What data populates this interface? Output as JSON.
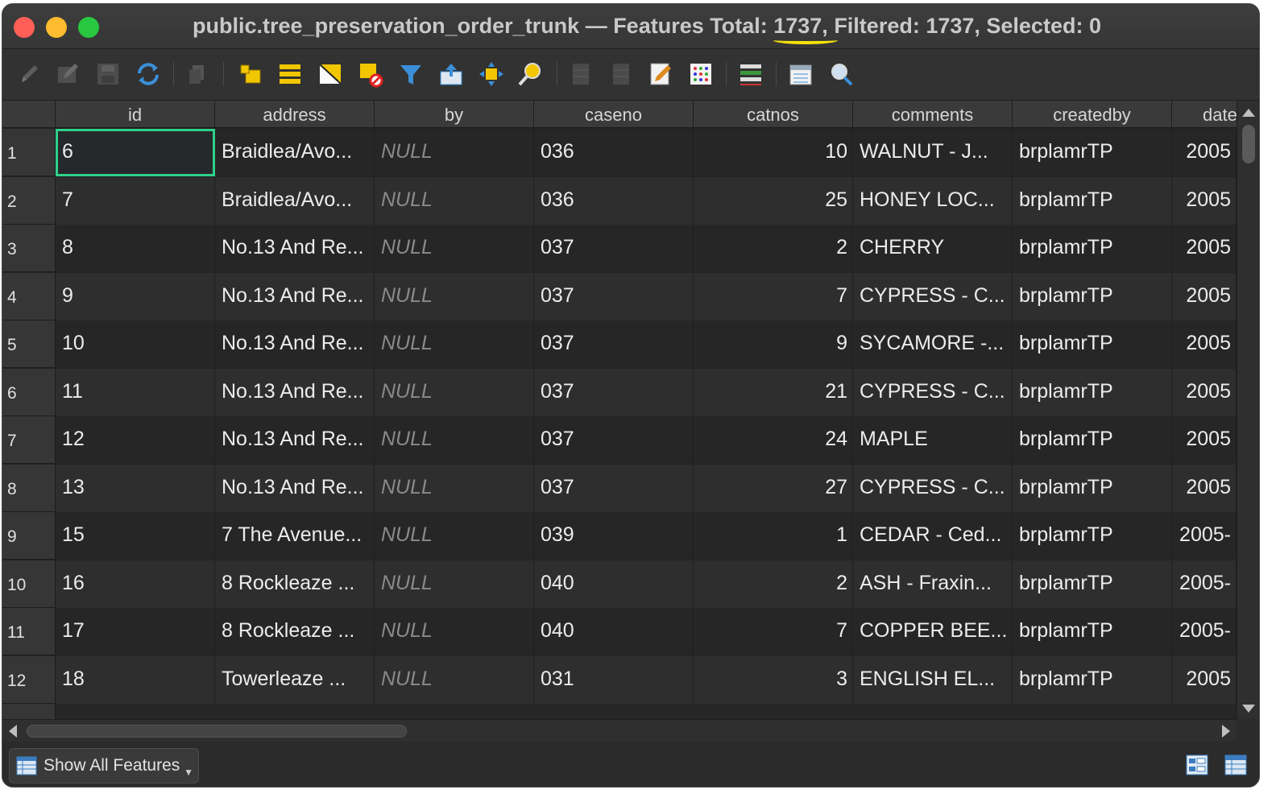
{
  "window": {
    "title_prefix": "public.tree_preservation_order_trunk — Features Total: ",
    "total": "1737,",
    "title_suffix": " Filtered: 1737, Selected: 0"
  },
  "toolbar": {
    "icons": [
      "pencil-icon",
      "multi-edit-icon",
      "save-edits-icon",
      "reload-icon",
      "copy-icon",
      "add-feature-icon",
      "select-all-icon",
      "invert-selection-icon",
      "deselect-icon",
      "filter-icon",
      "move-selection-top-icon",
      "pan-to-selection-icon",
      "zoom-to-selection-icon",
      "new-field-icon",
      "delete-field-icon",
      "field-calculator-icon",
      "conditional-format-icon",
      "dock-icon",
      "actions-icon",
      "organize-columns-icon"
    ]
  },
  "table": {
    "columns": [
      "id",
      "address",
      "by",
      "caseno",
      "catnos",
      "comments",
      "createdby",
      "date"
    ],
    "rows": [
      {
        "n": "1",
        "id": "6",
        "address": "Braidlea/Avo...",
        "by": "NULL",
        "caseno": "036",
        "catnos": "10",
        "comments": "WALNUT - J...",
        "createdby": "brplamrTP",
        "date": "2005"
      },
      {
        "n": "2",
        "id": "7",
        "address": "Braidlea/Avo...",
        "by": "NULL",
        "caseno": "036",
        "catnos": "25",
        "comments": "HONEY LOC...",
        "createdby": "brplamrTP",
        "date": "2005"
      },
      {
        "n": "3",
        "id": "8",
        "address": "No.13 And Re...",
        "by": "NULL",
        "caseno": "037",
        "catnos": "2",
        "comments": "CHERRY",
        "createdby": "brplamrTP",
        "date": "2005"
      },
      {
        "n": "4",
        "id": "9",
        "address": "No.13 And Re...",
        "by": "NULL",
        "caseno": "037",
        "catnos": "7",
        "comments": "CYPRESS - C...",
        "createdby": "brplamrTP",
        "date": "2005"
      },
      {
        "n": "5",
        "id": "10",
        "address": "No.13 And Re...",
        "by": "NULL",
        "caseno": "037",
        "catnos": "9",
        "comments": "SYCAMORE -...",
        "createdby": "brplamrTP",
        "date": "2005"
      },
      {
        "n": "6",
        "id": "11",
        "address": "No.13 And Re...",
        "by": "NULL",
        "caseno": "037",
        "catnos": "21",
        "comments": "CYPRESS - C...",
        "createdby": "brplamrTP",
        "date": "2005"
      },
      {
        "n": "7",
        "id": "12",
        "address": "No.13 And Re...",
        "by": "NULL",
        "caseno": "037",
        "catnos": "24",
        "comments": "MAPLE",
        "createdby": "brplamrTP",
        "date": "2005"
      },
      {
        "n": "8",
        "id": "13",
        "address": "No.13 And Re...",
        "by": "NULL",
        "caseno": "037",
        "catnos": "27",
        "comments": "CYPRESS - C...",
        "createdby": "brplamrTP",
        "date": "2005"
      },
      {
        "n": "9",
        "id": "15",
        "address": "7 The Avenue...",
        "by": "NULL",
        "caseno": "039",
        "catnos": "1",
        "comments": "CEDAR - Ced...",
        "createdby": "brplamrTP",
        "date": "2005-"
      },
      {
        "n": "10",
        "id": "16",
        "address": "8 Rockleaze ...",
        "by": "NULL",
        "caseno": "040",
        "catnos": "2",
        "comments": "ASH - Fraxin...",
        "createdby": "brplamrTP",
        "date": "2005-"
      },
      {
        "n": "11",
        "id": "17",
        "address": "8 Rockleaze ...",
        "by": "NULL",
        "caseno": "040",
        "catnos": "7",
        "comments": "COPPER BEE...",
        "createdby": "brplamrTP",
        "date": "2005-"
      },
      {
        "n": "12",
        "id": "18",
        "address": "Towerleaze ...",
        "by": "NULL",
        "caseno": "031",
        "catnos": "3",
        "comments": "ENGLISH EL...",
        "createdby": "brplamrTP",
        "date": "2005"
      }
    ]
  },
  "footer": {
    "show_all_label": "Show All Features"
  },
  "colors": {
    "selection_outline": "#2fd18a",
    "highlight_underline": "#f6e20a"
  }
}
